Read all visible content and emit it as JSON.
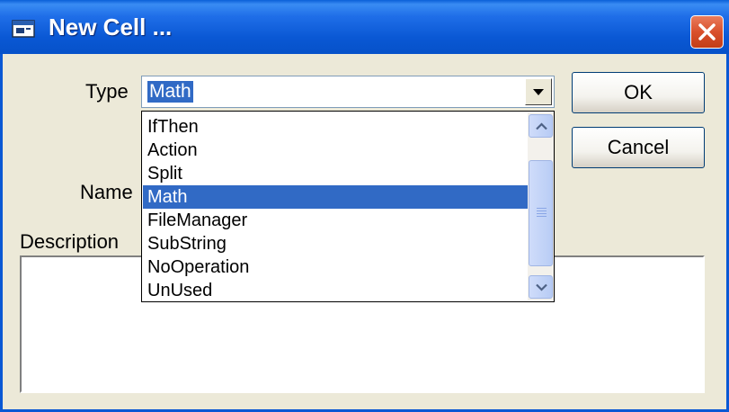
{
  "window": {
    "title": "New Cell ...",
    "icons": {
      "app": "cell-window-icon",
      "close": "close-icon"
    },
    "colors": {
      "titlebar": "#0a58d4",
      "selection": "#316ac5",
      "dialog": "#ece9d8",
      "close": "#d9502c"
    }
  },
  "form": {
    "type_label": "Type",
    "type_value": "Math",
    "name_label": "Name",
    "name_value": "",
    "description_label": "Description",
    "description_value": ""
  },
  "buttons": {
    "ok": "OK",
    "cancel": "Cancel"
  },
  "dropdown": {
    "items": [
      {
        "label": "IfThen"
      },
      {
        "label": "Action"
      },
      {
        "label": "Split"
      },
      {
        "label": "Math"
      },
      {
        "label": "FileManager"
      },
      {
        "label": "SubString"
      },
      {
        "label": "NoOperation"
      },
      {
        "label": "UnUsed"
      }
    ],
    "selected_index": 3,
    "icons": {
      "scroll_up": "scroll-up-arrow-icon",
      "scroll_down": "scroll-down-arrow-icon",
      "open": "chevron-down-icon"
    }
  }
}
